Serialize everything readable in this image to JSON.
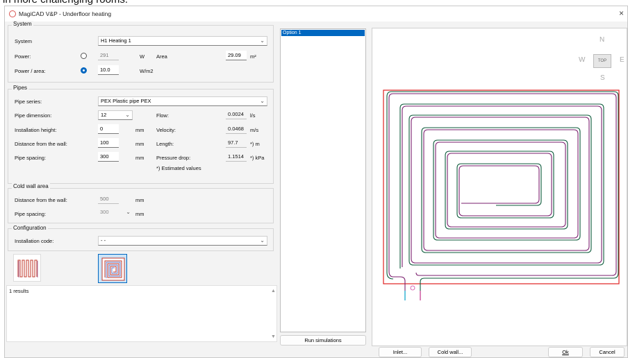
{
  "caption": "in more challenging rooms.",
  "window": {
    "title": "MagiCAD V&P - Underfloor heating",
    "close_glyph": "×"
  },
  "system_group": {
    "title": "System",
    "system_label": "System",
    "system_value": "H1    Heating 1",
    "power_label": "Power:",
    "power_value": "291",
    "power_unit": "W",
    "area_label": "Area",
    "area_value": "29.09",
    "area_unit": "m²",
    "power_area_label": "Power / area:",
    "power_area_value": "10.0",
    "power_area_unit": "W/m2"
  },
  "pipes_group": {
    "title": "Pipes",
    "series_label": "Pipe series:",
    "series_value": "PEX          Plastic pipe PEX",
    "dimension_label": "Pipe dimension:",
    "dimension_value": "12",
    "flow_label": "Flow:",
    "flow_value": "0.0024",
    "flow_unit": "l/s",
    "height_label": "Installation height:",
    "height_value": "0",
    "height_unit": "mm",
    "velocity_label": "Velocity:",
    "velocity_value": "0.0468",
    "velocity_unit": "m/s",
    "distance_label": "Distance from the wall:",
    "distance_value": "100",
    "distance_unit": "mm",
    "length_label": "Length:",
    "length_value": "97.7",
    "length_unit": "*)  m",
    "spacing_label": "Pipe spacing:",
    "spacing_value": "300",
    "spacing_unit": "mm",
    "pressure_label": "Pressure drop:",
    "pressure_value": "1.1514",
    "pressure_unit": "*)  kPa",
    "note": "*)  Estimated values"
  },
  "cold_group": {
    "title": "Cold wall area",
    "distance_label": "Distance from the wall:",
    "distance_value": "500",
    "distance_unit": "mm",
    "spacing_label": "Pipe spacing:",
    "spacing_value": "300",
    "spacing_unit": "mm"
  },
  "config_group": {
    "title": "Configuration",
    "code_label": "Installation code:",
    "code_value": "- -"
  },
  "results": {
    "text": "1 results"
  },
  "options": {
    "items": [
      "Option 1"
    ]
  },
  "buttons": {
    "run": "Run simulations",
    "inlet": "Inlet...",
    "cold_wall": "Cold wall...",
    "ok": "Ok",
    "cancel": "Cancel"
  },
  "compass": {
    "n": "N",
    "s": "S",
    "e": "E",
    "w": "W",
    "top": "TOP"
  },
  "colors": {
    "accent": "#0067c0",
    "room_border": "#e02020",
    "pipe_supply": "#7a1e6e",
    "pipe_return": "#0b5a3a",
    "title_icon": "#d9534f"
  }
}
